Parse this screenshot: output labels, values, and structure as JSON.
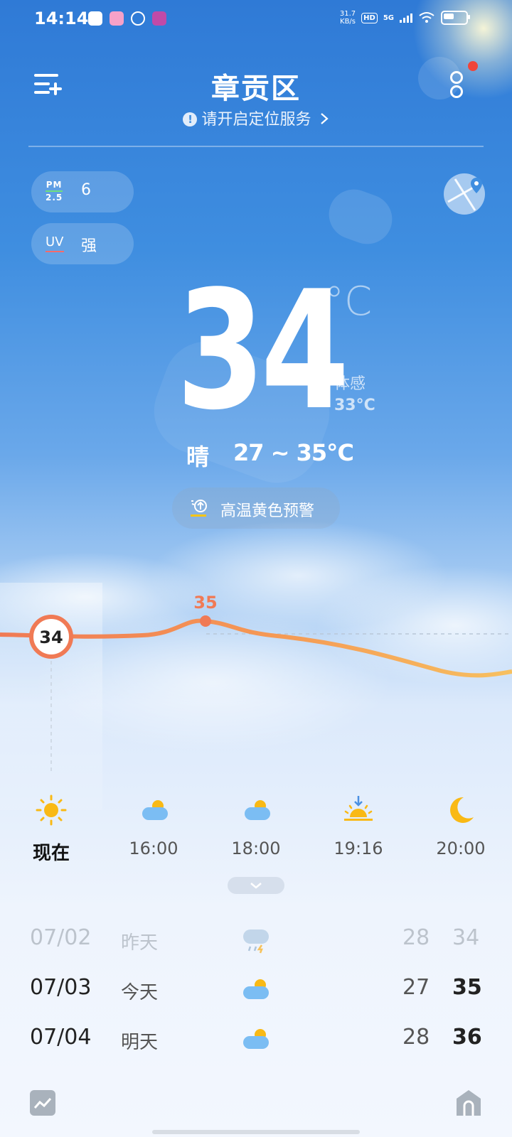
{
  "status_bar": {
    "time": "14:14",
    "net_speed_value": "31.7",
    "net_speed_unit": "KB/s",
    "hd_label": "HD",
    "network_label": "5G"
  },
  "header": {
    "city": "章贡区",
    "location_prompt": "请开启定位服务"
  },
  "air": {
    "pm_label_top": "PM",
    "pm_label_bottom": "2.5",
    "pm_value": "6",
    "uv_label": "UV",
    "uv_value": "强"
  },
  "current": {
    "temp": "34",
    "unit": "°C",
    "feels_label": "体感",
    "feels_value": "33°C",
    "condition": "晴",
    "range": "27 ~ 35℃",
    "alert": "高温黄色预警"
  },
  "hourly_chart": {
    "now_value": "34",
    "peak_value": "35"
  },
  "chart_data": {
    "type": "line",
    "categories": [
      "现在",
      "16:00",
      "18:00",
      "19:16",
      "20:00"
    ],
    "series": [
      {
        "values": [
          34,
          35,
          33,
          31,
          30
        ]
      }
    ],
    "labels_shown": [
      {
        "x": "现在",
        "text": "34"
      },
      {
        "x": "16:00",
        "text": "35"
      }
    ]
  },
  "hourly": [
    {
      "label": "现在",
      "icon": "sun-icon"
    },
    {
      "label": "16:00",
      "icon": "cloud-sun-icon"
    },
    {
      "label": "18:00",
      "icon": "cloud-sun-icon"
    },
    {
      "label": "19:16",
      "icon": "sunset-icon"
    },
    {
      "label": "20:00",
      "icon": "moon-icon"
    }
  ],
  "daily": [
    {
      "date": "07/02",
      "name": "昨天",
      "icon": "thunder-rain-icon",
      "low": "28",
      "high": "34"
    },
    {
      "date": "07/03",
      "name": "今天",
      "icon": "cloud-sun-icon",
      "low": "27",
      "high": "35"
    },
    {
      "date": "07/04",
      "name": "明天",
      "icon": "cloud-sun-icon",
      "low": "28",
      "high": "36"
    }
  ],
  "colors": {
    "accent_warm": "#f07a55",
    "curve_end": "#f7b65d",
    "sun_yellow": "#f9b915",
    "cloud_blue": "#7bbdf3"
  }
}
